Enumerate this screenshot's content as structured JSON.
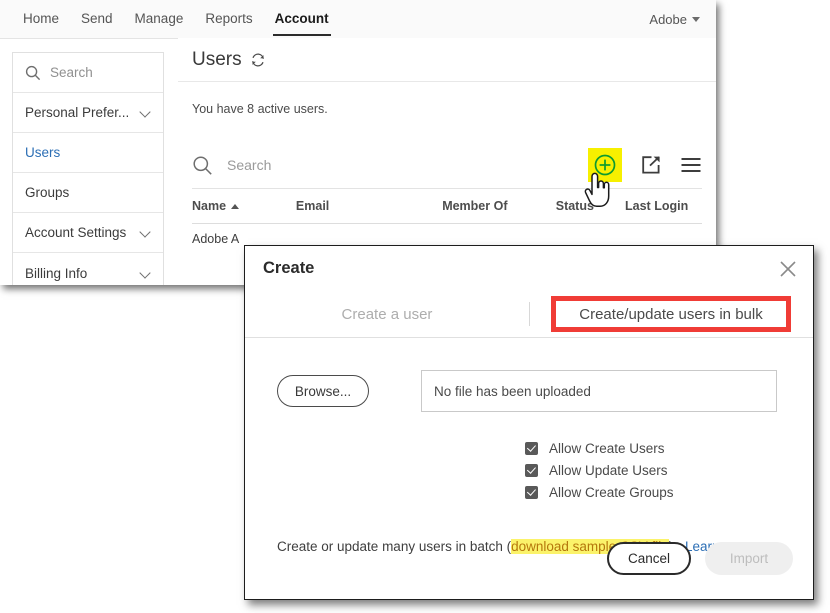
{
  "topnav": {
    "items": [
      {
        "label": "Home",
        "active": false
      },
      {
        "label": "Send",
        "active": false
      },
      {
        "label": "Manage",
        "active": false
      },
      {
        "label": "Reports",
        "active": false
      },
      {
        "label": "Account",
        "active": true
      }
    ],
    "account_menu": "Adobe"
  },
  "sidebar": {
    "search_placeholder": "Search",
    "items": [
      {
        "label": "Personal Prefer...",
        "chevron": true,
        "active": false
      },
      {
        "label": "Users",
        "chevron": false,
        "active": true
      },
      {
        "label": "Groups",
        "chevron": false,
        "active": false
      },
      {
        "label": "Account Settings",
        "chevron": true,
        "active": false
      },
      {
        "label": "Billing Info",
        "chevron": true,
        "active": false
      }
    ]
  },
  "main": {
    "page_title": "Users",
    "active_users_text": "You have 8 active users.",
    "toolbar": {
      "search_placeholder": "Search",
      "add_user_title": "Add user",
      "export_title": "Export",
      "menu_title": "Menu"
    },
    "table": {
      "columns": [
        "Name",
        "Email",
        "Member Of",
        "Status",
        "Last Login"
      ],
      "sort_column": "Name",
      "sort_direction": "ascending",
      "rows": [
        {
          "name": "Adobe A"
        }
      ]
    }
  },
  "dialog": {
    "title": "Create",
    "close_label": "×",
    "tabs": [
      {
        "label": "Create a user",
        "active": false
      },
      {
        "label": "Create/update users in bulk",
        "active": true
      }
    ],
    "browse_button": "Browse...",
    "file_field_value": "No file has been uploaded",
    "checkboxes": [
      {
        "label": "Allow Create Users",
        "checked": true
      },
      {
        "label": "Allow Update Users",
        "checked": true
      },
      {
        "label": "Allow Create Groups",
        "checked": true
      }
    ],
    "batch_text_before": "Create or update many users in batch (",
    "batch_link": "download sample CSV file",
    "batch_text_after": ").",
    "learn_more": "Learn more...",
    "cancel_button": "Cancel",
    "import_button": "Import"
  },
  "colors": {
    "highlight_yellow": "#f7f000",
    "annotation_red": "#f03c36",
    "link_blue": "#2d6fb5",
    "csv_link": "#b5770c",
    "add_icon_green": "#0d9b2f"
  }
}
